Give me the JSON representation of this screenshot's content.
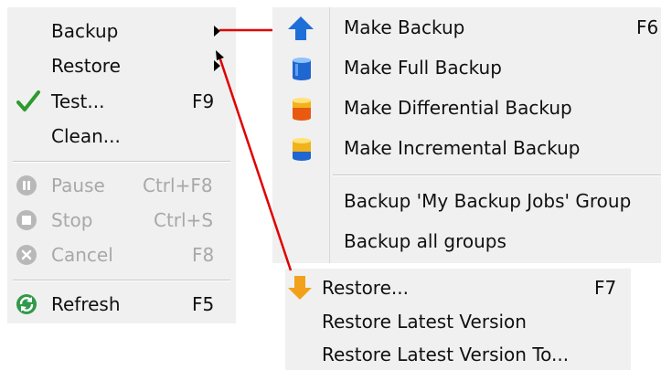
{
  "main_menu": {
    "items": [
      {
        "label": "Backup"
      },
      {
        "label": "Restore"
      },
      {
        "label": "Test...",
        "shortcut": "F9"
      },
      {
        "label": "Clean..."
      },
      {
        "label": "Pause",
        "shortcut": "Ctrl+F8"
      },
      {
        "label": "Stop",
        "shortcut": "Ctrl+S"
      },
      {
        "label": "Cancel",
        "shortcut": "F8"
      },
      {
        "label": "Refresh",
        "shortcut": "F5"
      }
    ]
  },
  "backup_menu": {
    "items": [
      {
        "label": "Make Backup",
        "shortcut": "F6"
      },
      {
        "label": "Make Full Backup"
      },
      {
        "label": "Make Differential Backup"
      },
      {
        "label": "Make Incremental Backup"
      },
      {
        "label": "Backup 'My Backup Jobs' Group"
      },
      {
        "label": "Backup all groups"
      }
    ]
  },
  "restore_menu": {
    "items": [
      {
        "label": "Restore...",
        "shortcut": "F7"
      },
      {
        "label": "Restore Latest Version"
      },
      {
        "label": "Restore Latest Version To..."
      }
    ]
  },
  "icons": {
    "test": "checkmark-icon",
    "pause": "pause-icon",
    "stop": "stop-icon",
    "cancel": "cancel-icon",
    "refresh": "refresh-icon",
    "make_backup": "arrow-up-icon",
    "full_backup": "database-blue-icon",
    "differential_backup": "database-orange-icon",
    "incremental_backup": "database-yellow-icon",
    "restore": "arrow-down-icon"
  },
  "colors": {
    "menu_bg": "#f0f0f0",
    "disabled_text": "#a8a8a8",
    "connector_line": "#e00000"
  }
}
